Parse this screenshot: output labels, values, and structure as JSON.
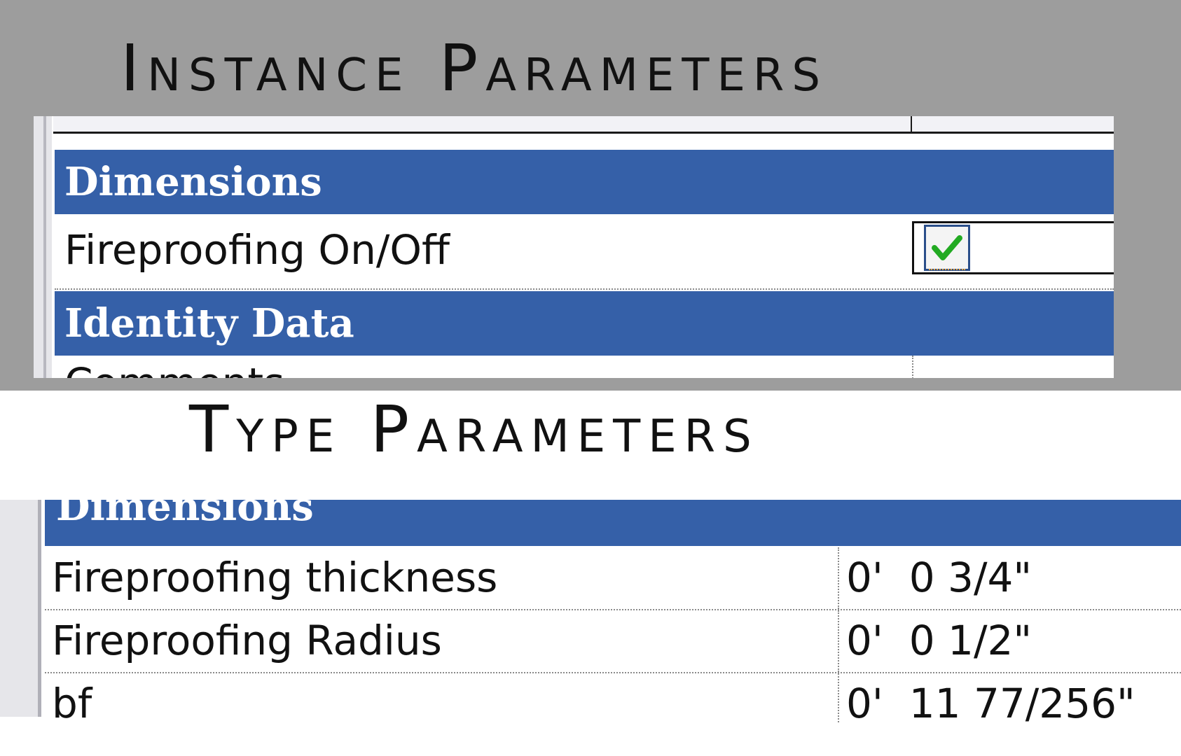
{
  "instance_section": {
    "heading": "Instance Parameters",
    "groups": {
      "dimensions": "Dimensions",
      "identity": "Identity Data"
    },
    "rows": {
      "fireproofing_on_off": {
        "label": "Fireproofing On/Off",
        "checked": true
      },
      "comments": {
        "label": "Comments"
      }
    }
  },
  "type_section": {
    "heading": "Type Parameters",
    "group": "Dimensions",
    "rows": [
      {
        "label": "Fireproofing thickness",
        "value": "0'  0 3/4\""
      },
      {
        "label": "Fireproofing Radius",
        "value": "0'  0 1/2\""
      },
      {
        "label": "bf",
        "value": "0'  11 77/256\""
      }
    ]
  },
  "colors": {
    "group_header": "#3560a8",
    "top_band": "#9d9d9d",
    "checkmark": "#22aa22"
  },
  "icons": {
    "checkbox": "checkmark-icon"
  }
}
